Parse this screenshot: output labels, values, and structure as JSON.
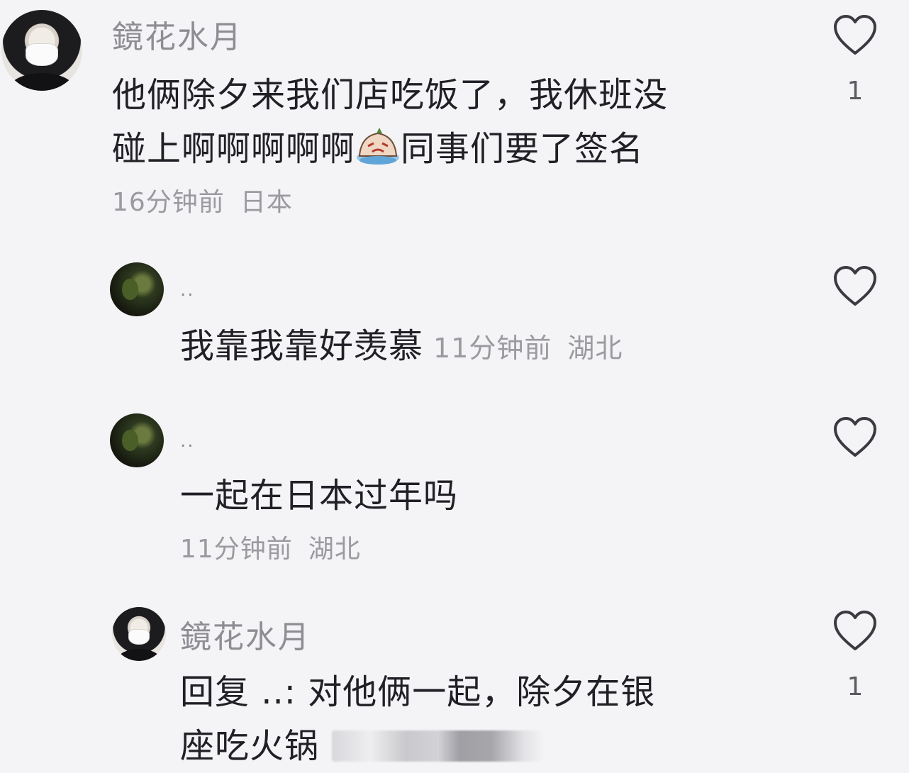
{
  "comments": [
    {
      "username": "鏡花水月",
      "text_line1": "他俩除夕来我们店吃饭了，我休班没",
      "text_line2_before": "碰上啊啊啊啊啊",
      "text_line2_after": "同事们要了签名",
      "emoji": "crying-emoji",
      "time": "16分钟前",
      "region": "日本",
      "likes": "1"
    },
    {
      "username": "..",
      "text": "我靠我靠好羡慕",
      "time": "11分钟前",
      "region": "湖北",
      "likes": ""
    },
    {
      "username": "..",
      "text": "一起在日本过年吗",
      "time": "11分钟前",
      "region": "湖北",
      "likes": ""
    },
    {
      "username": "鏡花水月",
      "text_line1": "回复 ..: 对他俩一起，除夕在银",
      "text_line2": "座吃火锅",
      "likes": "1"
    }
  ],
  "icons": {
    "like": "heart-outline-icon"
  },
  "colors": {
    "background": "#f4f4f6",
    "text": "#202026",
    "meta": "#9a9aa0"
  }
}
